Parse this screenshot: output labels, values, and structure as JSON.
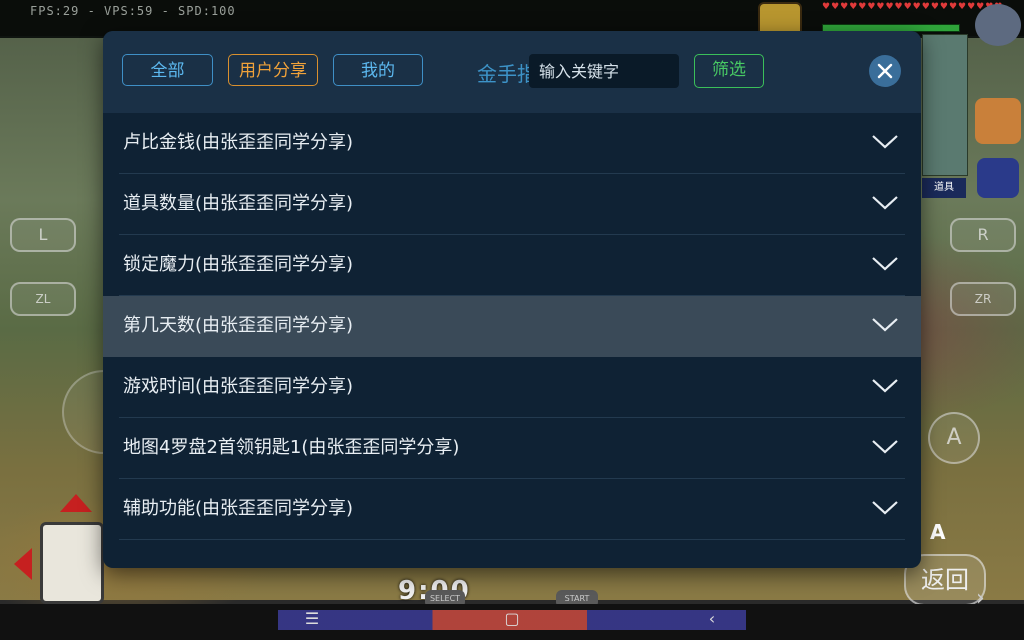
{
  "hud": {
    "fps_text": "FPS:29 - VPS:59 - SPD:100",
    "item_label": "道具",
    "clock": "9:00"
  },
  "controls": {
    "l": "L",
    "zl": "ZL",
    "r": "R",
    "zr": "ZR",
    "a": "A",
    "back": "返回",
    "select": "SELECT",
    "start": "START"
  },
  "dialog": {
    "tabs": [
      {
        "label": "全部",
        "active": false
      },
      {
        "label": "用户分享",
        "active": true
      },
      {
        "label": "我的",
        "active": false
      }
    ],
    "title": "金手指",
    "search_placeholder": "输入关键字",
    "filter_label": "筛选",
    "items": [
      {
        "label": "卢比金钱(由张歪歪同学分享)",
        "selected": false
      },
      {
        "label": "道具数量(由张歪歪同学分享)",
        "selected": false
      },
      {
        "label": "锁定魔力(由张歪歪同学分享)",
        "selected": false
      },
      {
        "label": "第几天数(由张歪歪同学分享)",
        "selected": true
      },
      {
        "label": "游戏时间(由张歪歪同学分享)",
        "selected": false
      },
      {
        "label": "地图4罗盘2首领钥匙1(由张歪歪同学分享)",
        "selected": false
      },
      {
        "label": "辅助功能(由张歪歪同学分享)",
        "selected": false
      }
    ]
  },
  "nav": {
    "menu_icon": "menu-icon",
    "home_icon": "home-icon",
    "back_icon": "back-icon"
  },
  "colors": {
    "dialog_bg": "#0f2234",
    "header_bg": "#1a3046",
    "tab_blue": "#5cb8ef",
    "tab_active": "#f0a23a",
    "filter_green": "#48c964",
    "selected_row": "#3a4a58"
  }
}
